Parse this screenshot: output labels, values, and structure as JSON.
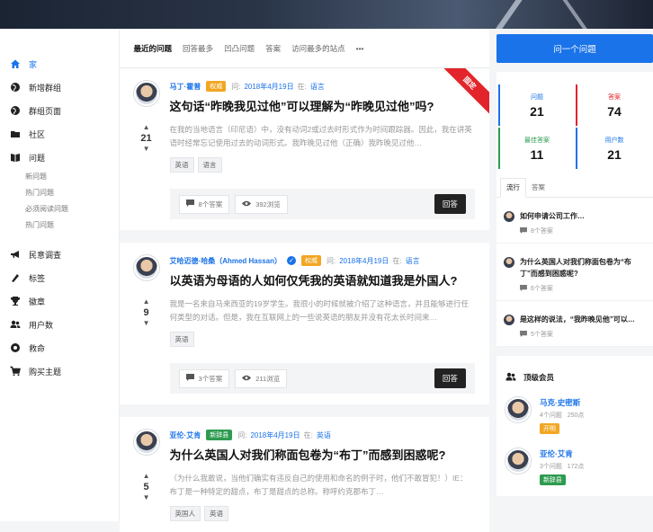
{
  "sidebar": {
    "items": [
      {
        "label": "家",
        "icon": "home-icon"
      },
      {
        "label": "新增群组",
        "icon": "globe-icon"
      },
      {
        "label": "群组页面",
        "icon": "globe-icon"
      },
      {
        "label": "社区",
        "icon": "folder-icon"
      },
      {
        "label": "问题",
        "icon": "book-icon"
      }
    ],
    "sub_items": [
      "新问题",
      "热门问题",
      "必须阅读问题",
      "热门问题"
    ],
    "items2": [
      {
        "label": "民意调查",
        "icon": "megaphone-icon"
      },
      {
        "label": "标签",
        "icon": "tag-icon"
      },
      {
        "label": "徽章",
        "icon": "trophy-icon"
      },
      {
        "label": "用户数",
        "icon": "users-icon"
      },
      {
        "label": "救命",
        "icon": "lifebuoy-icon"
      },
      {
        "label": "购买主题",
        "icon": "cart-icon"
      }
    ]
  },
  "tabs": [
    "最近的问题",
    "回答最多",
    "凹凸问题",
    "答案",
    "访问最多的站点"
  ],
  "tabs_more": "•••",
  "questions": [
    {
      "author": "马丁·霍普",
      "badge": "权威",
      "asked_label": "问:",
      "date": "2018年4月19日",
      "in_label": "在:",
      "category": "语言",
      "title": "这句话“昨晚我见过他”可以理解为“昨晚见过他”吗?",
      "excerpt": "在我的当地语言（印尼语）中，没有动词2或过去时形式作为时间跟踪器。因此，我在讲英语时经常忘记使用过去的动词形式。我昨晚见过他（正确）我昨晚见过他…",
      "votes": "21",
      "tags": [
        "英语",
        "语言"
      ],
      "answers": "8个答案",
      "views": "392浏览",
      "answer_btn": "回答",
      "ribbon": "固定"
    },
    {
      "author": "艾哈迈德·哈桑（Ahmed Hassan）",
      "badge": "权威",
      "asked_label": "问:",
      "date": "2018年4月19日",
      "in_label": "在:",
      "category": "语言",
      "title": "以英语为母语的人如何仅凭我的英语就知道我是外国人?",
      "excerpt": "我是一名来自马来西亚的19岁学生。我很小的时候就被介绍了这种语言，并且能够进行任何类型的对话。但是，我在互联网上的一些说英语的朋友并没有花太长时间来…",
      "votes": "9",
      "tags": [
        "英语"
      ],
      "answers": "3个答案",
      "views": "211浏览",
      "answer_btn": "回答"
    },
    {
      "author": "亚伦·艾肯",
      "badge": "新辞县",
      "asked_label": "问:",
      "date": "2018年4月19日",
      "in_label": "在:",
      "category": "英语",
      "title": "为什么英国人对我们称面包卷为“布丁”而感到困惑呢?",
      "excerpt": "（为什么我敢说，当他们确实有违反自己的使用和命名的例子时，他们不敢冒犯！）IE：布丁是一种特定的甜点，布丁是甜点的总称。称呼约克郡布丁…",
      "votes": "5",
      "tags": [
        "英国人",
        "英语"
      ]
    }
  ],
  "right": {
    "ask_btn": "问一个问题",
    "stats": [
      {
        "label": "问题",
        "value": "21",
        "color": "#1a73e8"
      },
      {
        "label": "答案",
        "value": "74",
        "color": "#e3242b"
      },
      {
        "label": "最佳答案",
        "value": "11",
        "color": "#2e9b4f"
      },
      {
        "label": "用户数",
        "value": "21",
        "color": "#1a73e8"
      }
    ],
    "feed_tabs": [
      "流行",
      "答案"
    ],
    "feed": [
      {
        "title": "如何申请公司工作…",
        "count": "8个答案"
      },
      {
        "title": "为什么英国人对我们称面包卷为“布丁”而感到困惑呢?",
        "count": "6个答案"
      },
      {
        "title": "是这样的说法，“我昨晚见他”可以…",
        "count": "5个答案"
      }
    ],
    "members_title": "顶级会员",
    "members": [
      {
        "name": "马克·史密斯",
        "questions": "4个问题",
        "points": "250点",
        "badge": "开明",
        "badge_color": "#f2a623"
      },
      {
        "name": "亚伦·艾肯",
        "questions": "3个问题",
        "points": "172点",
        "badge": "新辞县",
        "badge_color": "#2e9b4f"
      }
    ]
  }
}
